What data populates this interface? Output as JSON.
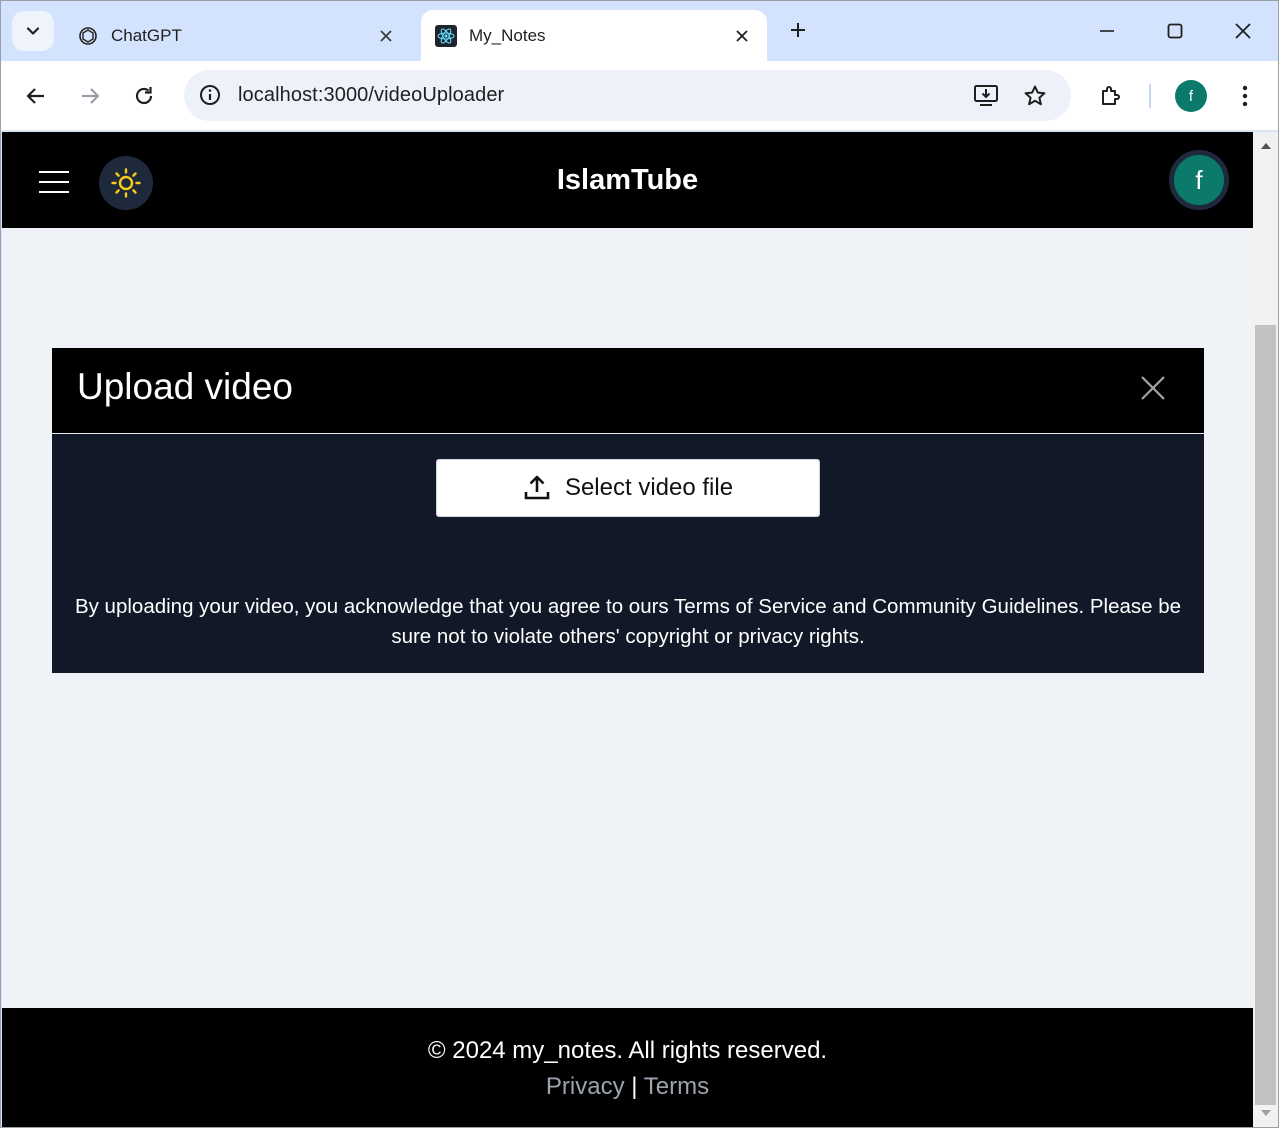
{
  "browser": {
    "tabs": [
      {
        "title": "ChatGPT",
        "icon": "chatgpt-icon",
        "active": false
      },
      {
        "title": "My_Notes",
        "icon": "react-icon",
        "active": true
      }
    ],
    "address_bar": {
      "url": "localhost:3000/videoUploader"
    },
    "profile_initial": "f"
  },
  "app": {
    "brand": "IslamTube",
    "avatar_initial": "f",
    "colors": {
      "header_bg": "#000000",
      "page_bg": "#eff2f7",
      "modal_bg": "#111827",
      "avatar_bg": "#0b7a6b",
      "sun_icon": "#facc15"
    }
  },
  "modal": {
    "title": "Upload video",
    "select_button_label": "Select video file",
    "note": "By uploading your video, you acknowledge that you agree to ours Terms of Service and Community Guidelines. Please be sure not to violate others' copyright or privacy rights."
  },
  "footer": {
    "copyright": "© 2024 my_notes. All rights reserved.",
    "privacy_label": "Privacy",
    "separator": "|",
    "terms_label": "Terms"
  }
}
